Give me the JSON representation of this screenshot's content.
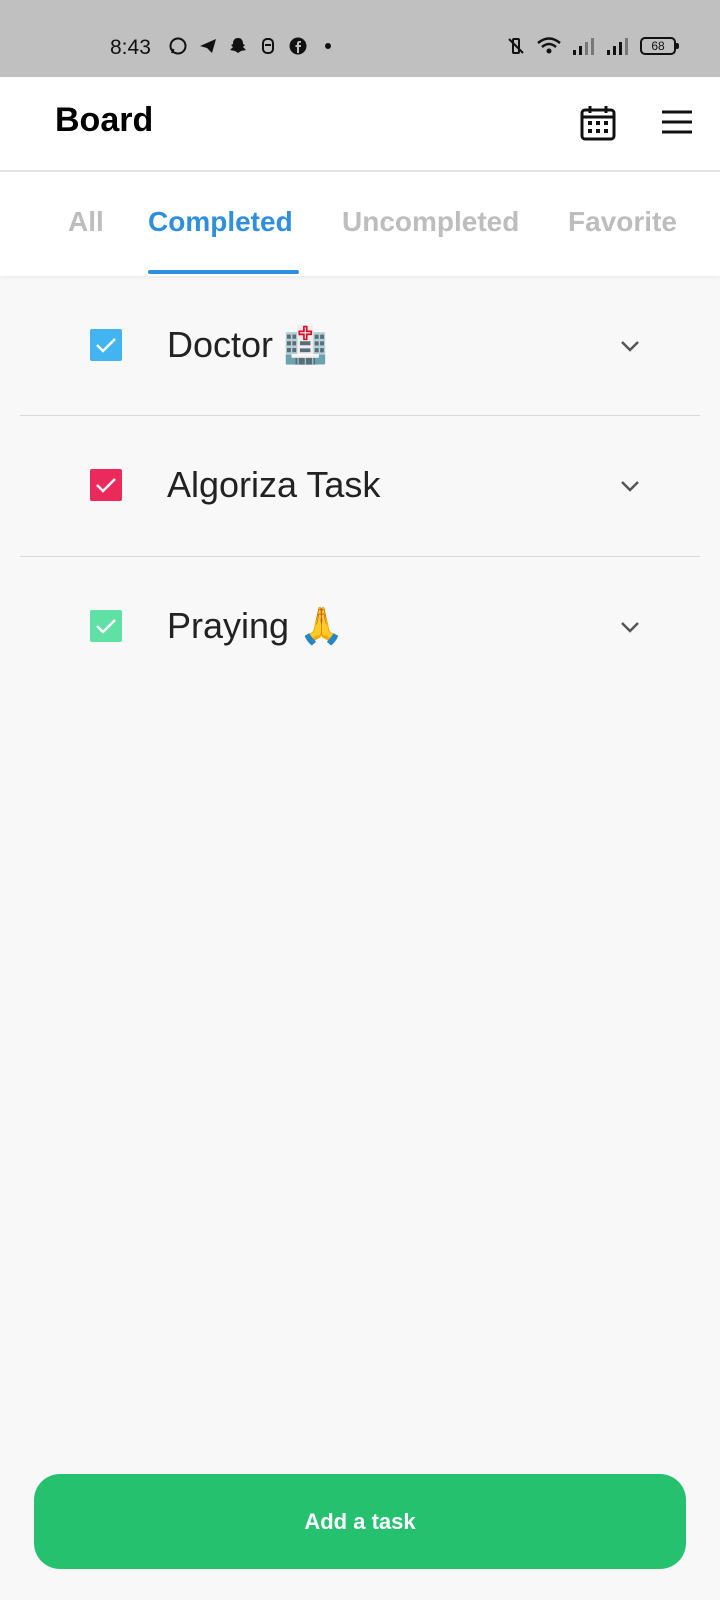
{
  "status_bar": {
    "time": "8:43",
    "notification_icons": [
      "whatsapp-icon",
      "telegram-icon",
      "snapchat-icon",
      "app-icon",
      "facebook-icon",
      "dot-icon"
    ],
    "system_icons": [
      "vibrate-icon",
      "wifi-icon",
      "signal-icon",
      "signal-icon"
    ],
    "battery": "68"
  },
  "appbar": {
    "title": "Board",
    "calendar_icon": "calendar-icon",
    "menu_icon": "menu-icon"
  },
  "tabs": [
    {
      "label": "All",
      "active": false
    },
    {
      "label": "Completed",
      "active": true
    },
    {
      "label": "Uncompleted",
      "active": false
    },
    {
      "label": "Favorite",
      "active": false
    }
  ],
  "tasks": [
    {
      "title": "Doctor 🏥",
      "checked": true,
      "color": "#42b4f0"
    },
    {
      "title": "Algoriza Task",
      "checked": true,
      "color": "#ea2a5a"
    },
    {
      "title": "Praying 🙏",
      "checked": true,
      "color": "#5fe0a5"
    }
  ],
  "colors": {
    "accent": "#2f8fdc",
    "add_button": "#25c16f",
    "status_bar": "#c0c0c0"
  },
  "add_button": {
    "label": "Add a task"
  }
}
